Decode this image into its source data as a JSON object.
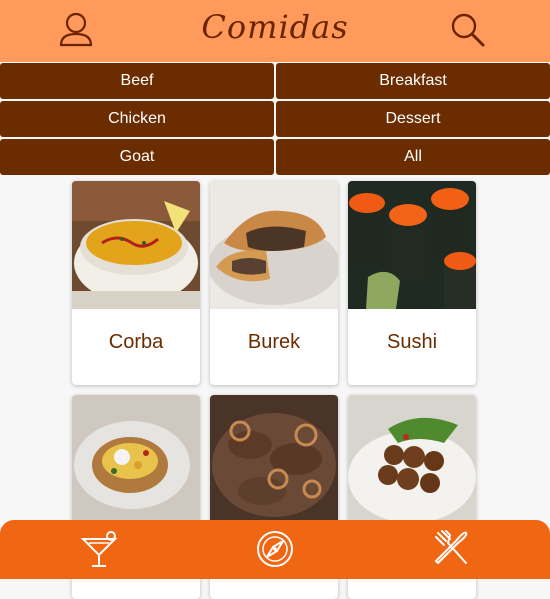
{
  "header": {
    "title": "Comidas",
    "icons": {
      "left": "user-icon",
      "right": "search-icon"
    }
  },
  "categories": [
    {
      "label": "Beef"
    },
    {
      "label": "Breakfast"
    },
    {
      "label": "Chicken"
    },
    {
      "label": "Dessert"
    },
    {
      "label": "Goat"
    },
    {
      "label": "All"
    }
  ],
  "recipes": [
    {
      "name": "Corba",
      "image": "corba-soup-photo"
    },
    {
      "name": "Burek",
      "image": "burek-pastry-photo"
    },
    {
      "name": "Sushi",
      "image": "sushi-rolls-photo"
    },
    {
      "name": "",
      "image": "stuffed-potato-photo"
    },
    {
      "name": "",
      "image": "beef-onions-photo"
    },
    {
      "name": "",
      "image": "falafel-plate-photo"
    }
  ],
  "bottom_nav": [
    {
      "icon": "cocktail-icon"
    },
    {
      "icon": "compass-icon"
    },
    {
      "icon": "fork-knife-icon"
    }
  ],
  "colors": {
    "header": "#ff9a5c",
    "title": "#6b2400",
    "category_button": "#6b2c00",
    "footer": "#f06612",
    "card_text": "#6b2c00"
  }
}
